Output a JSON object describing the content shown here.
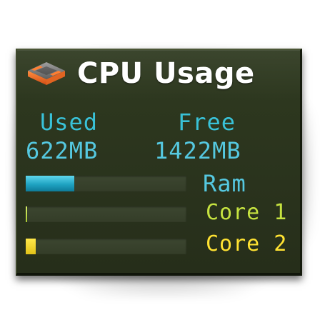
{
  "widget": {
    "title": "CPU Usage",
    "logo_icon": "cpu-chip-icon"
  },
  "memory": {
    "used_label": "Used",
    "free_label": "Free",
    "used_value": "622MB",
    "free_value": "1422MB"
  },
  "bars": [
    {
      "label": "Ram",
      "fraction": 0.3,
      "color": "#1fa3c2"
    },
    {
      "label": "Core 1",
      "fraction": 0.01,
      "color": "#a8c832"
    },
    {
      "label": "Core 2",
      "fraction": 0.06,
      "color": "#ffe232"
    }
  ],
  "colors": {
    "panel_background": "#2c351e",
    "title": "#ffffff",
    "memory_text": "#39c2d8"
  }
}
